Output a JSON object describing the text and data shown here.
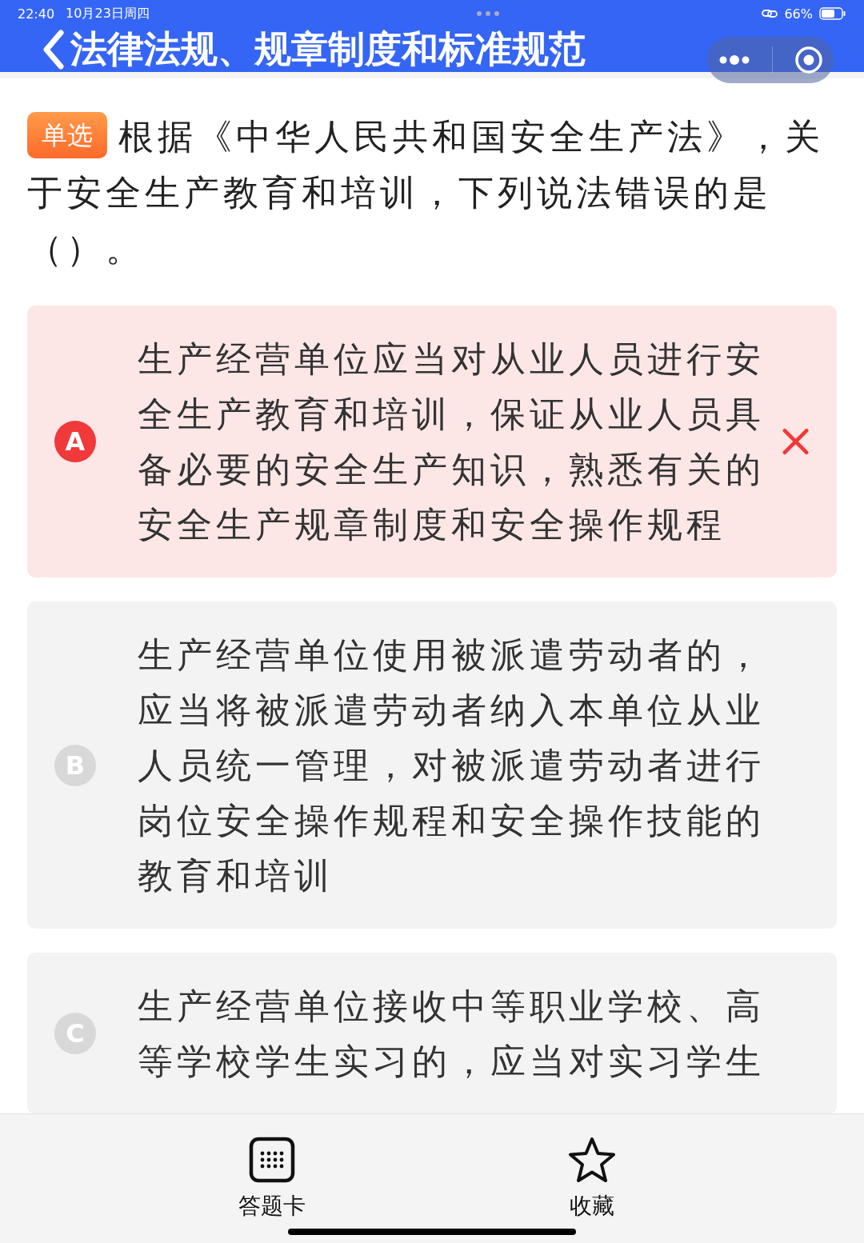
{
  "status_bar": {
    "time": "22:40",
    "date": "10月23日周四",
    "battery": "66%"
  },
  "nav": {
    "title": "法律法规、规章制度和标准规范"
  },
  "question": {
    "tag": "单选",
    "text": "根据《中华人民共和国安全生产法》，关于安全生产教育和培训，下列说法错误的是（）。"
  },
  "options": [
    {
      "letter": "A",
      "text": "生产经营单位应当对从业人员进行安全生产教育和培训，保证从业人员具备必要的安全生产知识，熟悉有关的安全生产规章制度和安全操作规程",
      "selected": true
    },
    {
      "letter": "B",
      "text": "生产经营单位使用被派遣劳动者的，应当将被派遣劳动者纳入本单位从业人员统一管理，对被派遣劳动者进行岗位安全操作规程和安全操作技能的教育和培训",
      "selected": false
    },
    {
      "letter": "C",
      "text": "生产经营单位接收中等职业学校、高等学校学生实习的，应当对实习学生",
      "selected": false
    }
  ],
  "bottom_bar": [
    {
      "kind": "grid",
      "label": "答题卡"
    },
    {
      "kind": "star",
      "label": "收藏"
    }
  ]
}
